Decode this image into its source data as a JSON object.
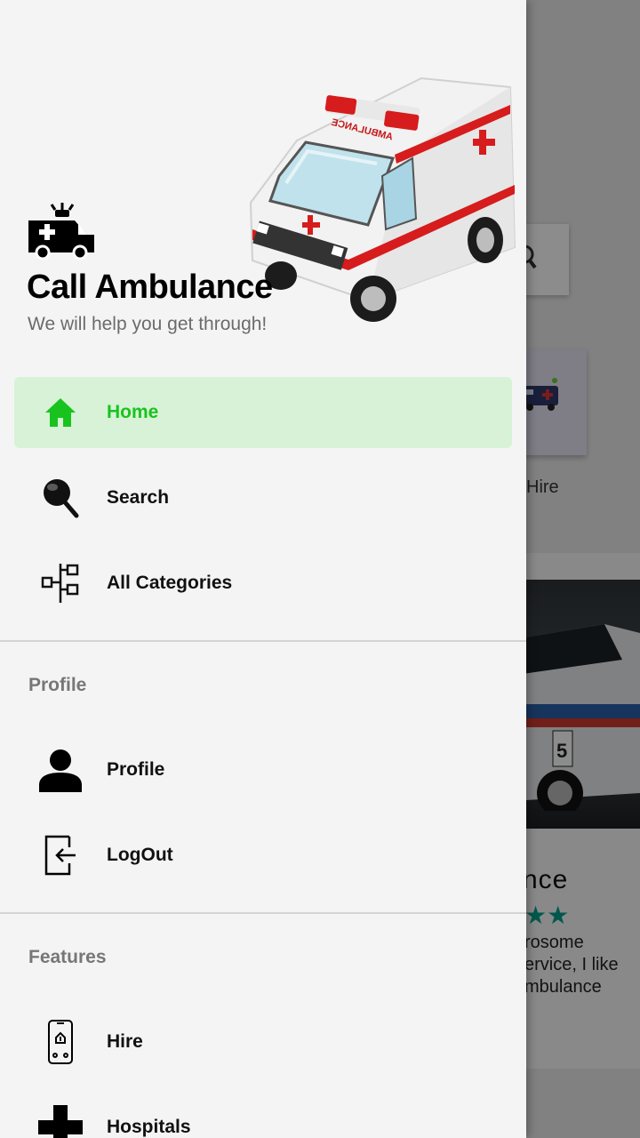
{
  "drawer": {
    "app_title": "Call Ambulance",
    "tagline": "We will help you get through!",
    "ambulance_text": "AMBULANCE",
    "menu": [
      {
        "label": "Home",
        "icon": "home-icon",
        "active": true
      },
      {
        "label": "Search",
        "icon": "search-icon",
        "active": false
      },
      {
        "label": "All Categories",
        "icon": "categories-icon",
        "active": false
      }
    ],
    "profile_section": {
      "title": "Profile",
      "items": [
        {
          "label": "Profile",
          "icon": "person-icon"
        },
        {
          "label": "LogOut",
          "icon": "logout-icon"
        }
      ]
    },
    "features_section": {
      "title": "Features",
      "items": [
        {
          "label": "Hire",
          "icon": "phone-icon"
        },
        {
          "label": "Hospitals",
          "icon": "medical-cross-icon"
        }
      ]
    },
    "colors": {
      "accent": "#19c31e",
      "active_bg": "#d7f2d6",
      "drawer_bg": "#f4f4f4"
    }
  },
  "background": {
    "hire_label": "Hire",
    "card_title": "nce",
    "review_text": "rosome\nervice, I like\nmbulance",
    "stars": "★★"
  }
}
